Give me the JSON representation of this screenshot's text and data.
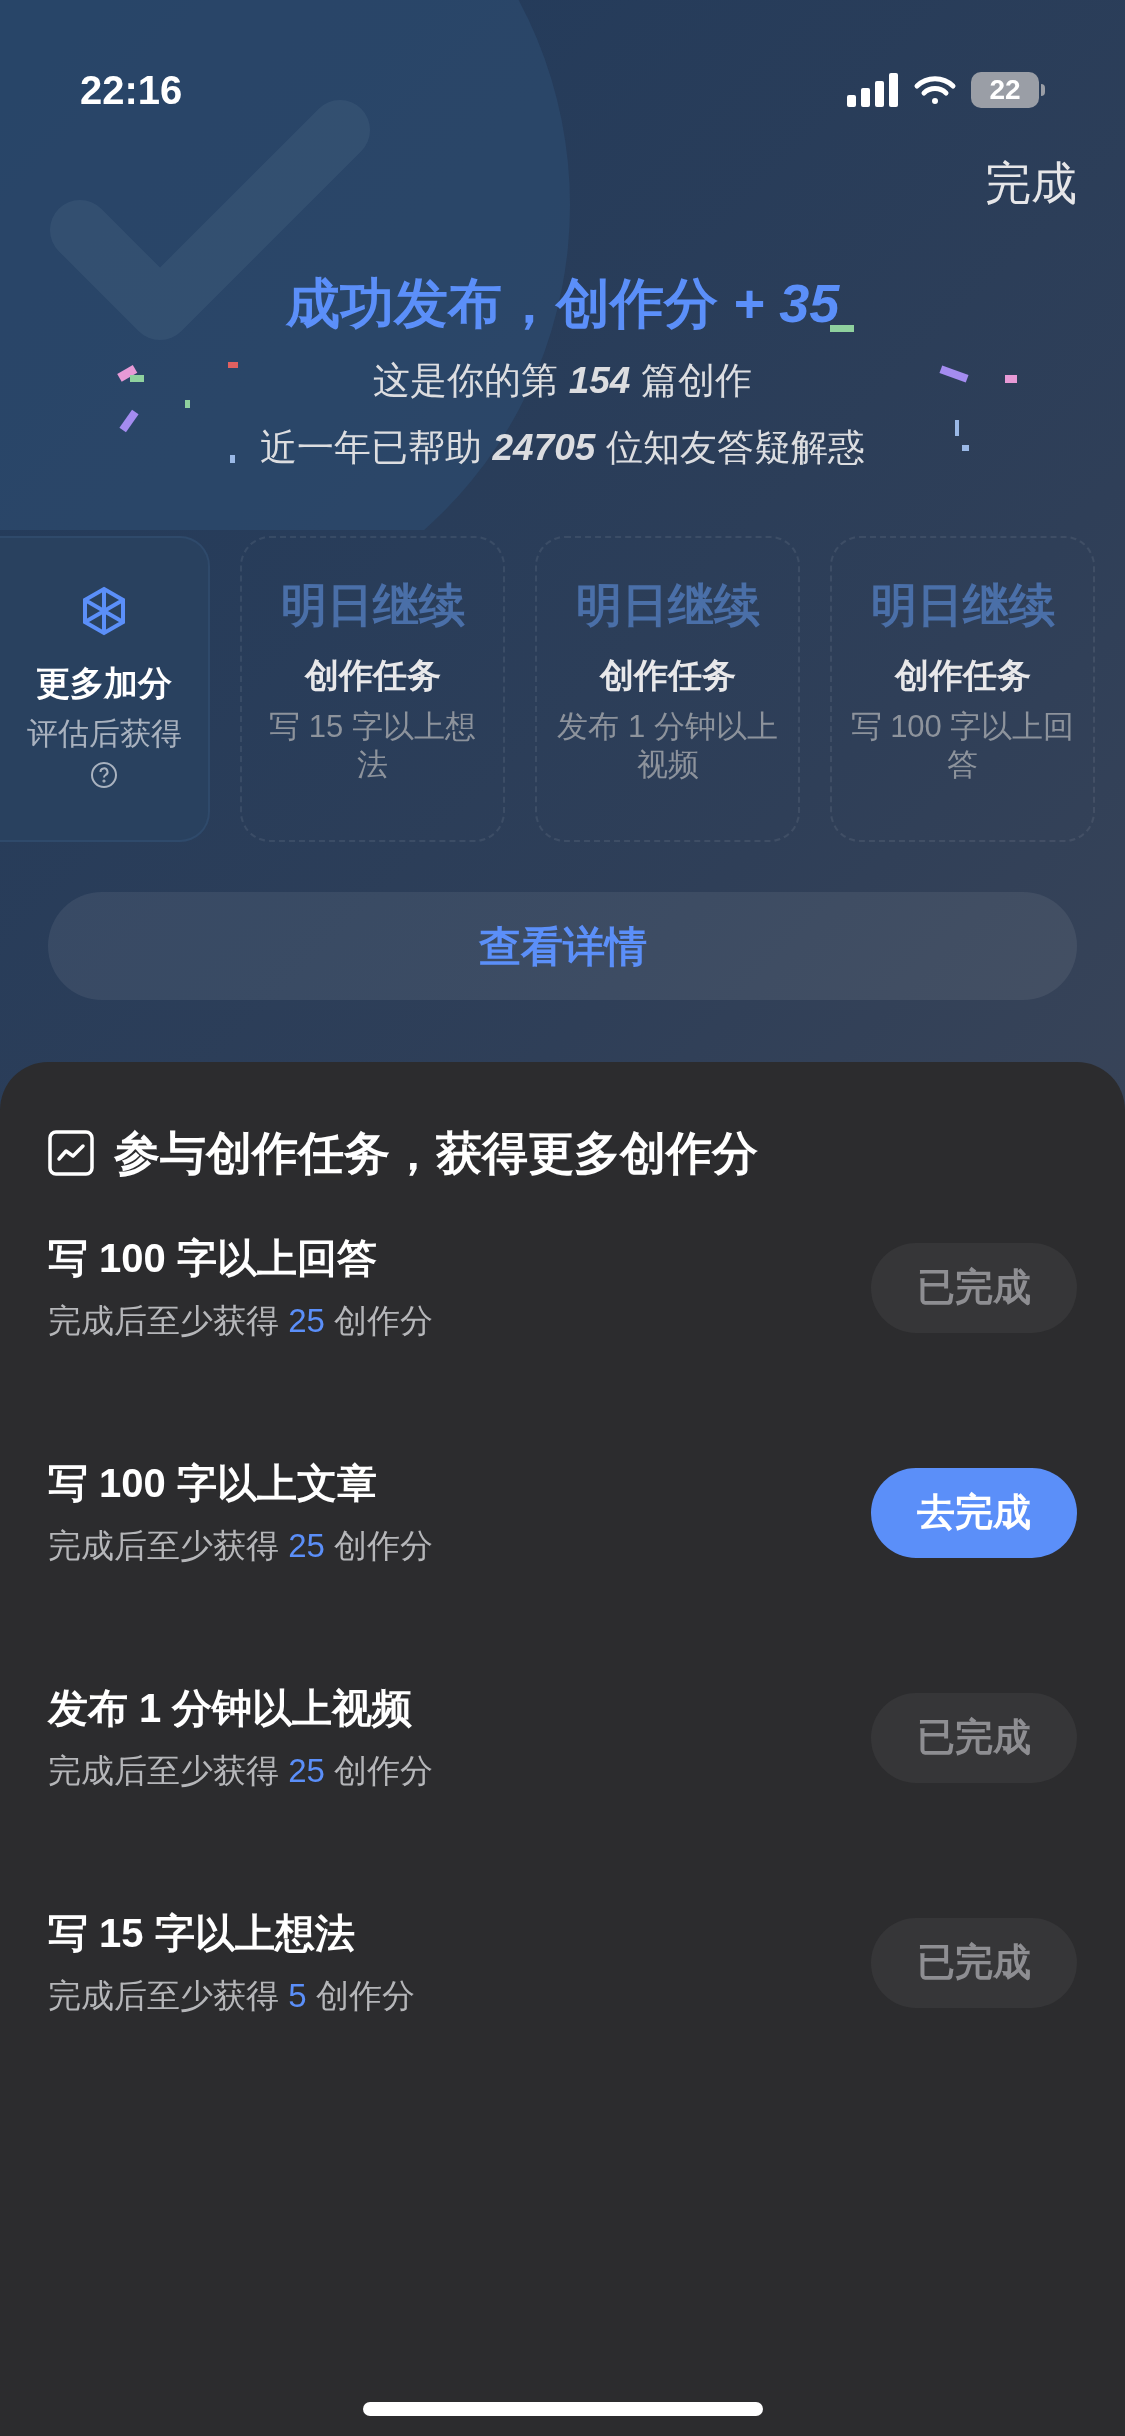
{
  "status_bar": {
    "time": "22:16",
    "battery": "22"
  },
  "done_link": "完成",
  "headline": "成功发布，创作分 *+ 35*",
  "stats": [
    "这是你的第 **154** 篇创作",
    "近一年已帮助 **24705** 位知友答疑解惑"
  ],
  "cards": [
    {
      "kind": "bonus",
      "title": "更多加分",
      "note": "评估后获得"
    },
    {
      "kind": "task",
      "status": "明日继续",
      "title": "创作任务",
      "desc": "写 15 字以上想法"
    },
    {
      "kind": "task",
      "status": "明日继续",
      "title": "创作任务",
      "desc": "发布 1 分钟以上视频"
    },
    {
      "kind": "task",
      "status": "明日继续",
      "title": "创作任务",
      "desc": "写 100 字以上回答"
    }
  ],
  "details_button": "查看详情",
  "sheet": {
    "title": "参与创作任务，获得更多创作分",
    "tasks": [
      {
        "title": "写 100 字以上回答",
        "reward": "完成后至少获得 **25** 创作分",
        "button": "已完成",
        "done": true
      },
      {
        "title": "写 100 字以上文章",
        "reward": "完成后至少获得 **25** 创作分",
        "button": "去完成",
        "done": false
      },
      {
        "title": "发布 1 分钟以上视频",
        "reward": "完成后至少获得 **25** 创作分",
        "button": "已完成",
        "done": true
      },
      {
        "title": "写 15 字以上想法",
        "reward": "完成后至少获得 **5** 创作分",
        "button": "已完成",
        "done": true
      }
    ]
  }
}
